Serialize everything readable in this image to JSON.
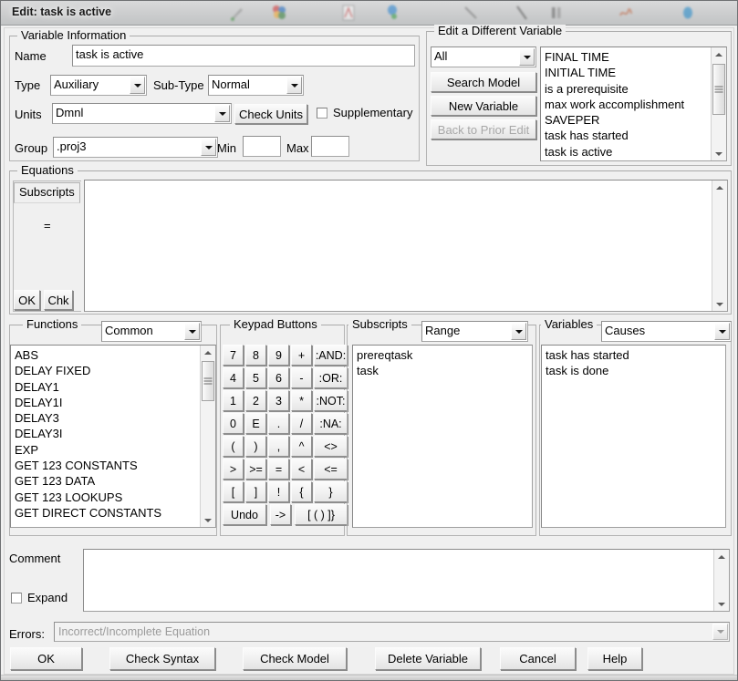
{
  "window": {
    "title": "Edit: task is active"
  },
  "variable_information": {
    "legend": "Variable Information",
    "name_label": "Name",
    "name_value": "task is active",
    "type_label": "Type",
    "type_value": "Auxiliary",
    "subtype_label": "Sub-Type",
    "subtype_value": "Normal",
    "units_label": "Units",
    "units_value": "Dmnl",
    "check_units_label": "Check Units",
    "supplementary_label": "Supplementary",
    "supplementary_checked": false,
    "group_label": "Group",
    "group_value": ".proj3",
    "min_label": "Min",
    "min_value": "",
    "max_label": "Max",
    "max_value": ""
  },
  "edit_different_variable": {
    "legend": "Edit a Different Variable",
    "filter_value": "All",
    "search_model_label": "Search Model",
    "new_variable_label": "New Variable",
    "back_to_prior_edit_label": "Back to Prior Edit",
    "back_to_prior_edit_disabled": true,
    "variables": [
      "FINAL TIME",
      "INITIAL TIME",
      "is a prerequisite",
      "max work accomplishment",
      "SAVEPER",
      "task has started",
      "task is active"
    ]
  },
  "equations": {
    "legend": "Equations",
    "tab_label": "Subscripts",
    "equals_sign": "=",
    "ok_label": "OK",
    "chk_label": "Chk",
    "editor_value": ""
  },
  "functions": {
    "legend": "Functions",
    "filter_value": "Common",
    "items": [
      "ABS",
      "DELAY FIXED",
      "DELAY1",
      "DELAY1I",
      "DELAY3",
      "DELAY3I",
      "EXP",
      "GET 123 CONSTANTS",
      "GET 123 DATA",
      "GET 123 LOOKUPS",
      "GET DIRECT CONSTANTS"
    ]
  },
  "keypad": {
    "legend": "Keypad Buttons",
    "rows": [
      [
        "7",
        "8",
        "9",
        "+",
        ":AND:"
      ],
      [
        "4",
        "5",
        "6",
        "-",
        ":OR:"
      ],
      [
        "1",
        "2",
        "3",
        "*",
        ":NOT:"
      ],
      [
        "0",
        "E",
        ".",
        "/",
        ":NA:"
      ],
      [
        "(",
        ")",
        ",",
        "^",
        "<>"
      ],
      [
        ">",
        ">=",
        "=",
        "<",
        "<="
      ],
      [
        "[",
        "]",
        "!",
        "{",
        "}"
      ]
    ],
    "last_row": [
      "Undo",
      "->",
      "[ ( ) ]}"
    ]
  },
  "subscripts": {
    "legend": "Subscripts",
    "filter_value": "Range",
    "items": [
      "prereqtask",
      "task"
    ]
  },
  "variables_panel": {
    "legend": "Variables",
    "filter_value": "Causes",
    "items": [
      "task has started",
      "task is done"
    ]
  },
  "comment": {
    "label": "Comment",
    "value": "",
    "expand_label": "Expand",
    "expand_checked": false
  },
  "errors": {
    "label": "Errors:",
    "value": "Incorrect/Incomplete Equation"
  },
  "footer": {
    "buttons": [
      "OK",
      "Check Syntax",
      "Check Model",
      "Delete Variable",
      "Cancel",
      "Help"
    ]
  },
  "colors": {
    "window_bg": "#f0f0f0",
    "field_bg": "#ffffff",
    "disabled_text": "#a8a8a8",
    "error_text": "#9b9b9b"
  }
}
